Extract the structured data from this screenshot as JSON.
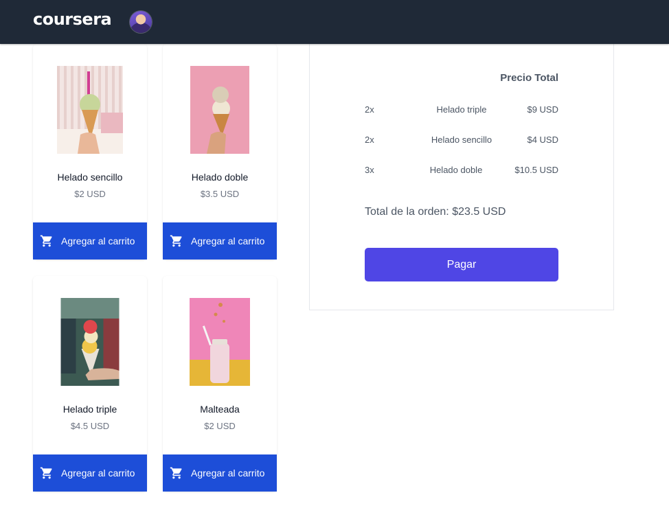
{
  "header": {
    "logo": "coursera"
  },
  "products": [
    {
      "name": "Helado sencillo",
      "price": "$2 USD",
      "button_label": "Agregar al carrito"
    },
    {
      "name": "Helado doble",
      "price": "$3.5 USD",
      "button_label": "Agregar al carrito"
    },
    {
      "name": "Helado triple",
      "price": "$4.5 USD",
      "button_label": "Agregar al carrito"
    },
    {
      "name": "Malteada",
      "price": "$2 USD",
      "button_label": "Agregar al carrito"
    }
  ],
  "summary": {
    "title": "Precio Total",
    "items": [
      {
        "qty": "2x",
        "name": "Helado triple",
        "price": "$9 USD"
      },
      {
        "qty": "2x",
        "name": "Helado sencillo",
        "price": "$4 USD"
      },
      {
        "qty": "3x",
        "name": "Helado doble",
        "price": "$10.5 USD"
      }
    ],
    "order_total": "Total de la orden: $23.5 USD",
    "pay_label": "Pagar"
  },
  "icons": {
    "cart": "shopping-cart-icon",
    "avatar": "user-avatar"
  },
  "colors": {
    "topbar": "#1f2937",
    "cart_button": "#1d4ed8",
    "pay_button": "#4f46e5",
    "text_muted": "#6b7280"
  }
}
